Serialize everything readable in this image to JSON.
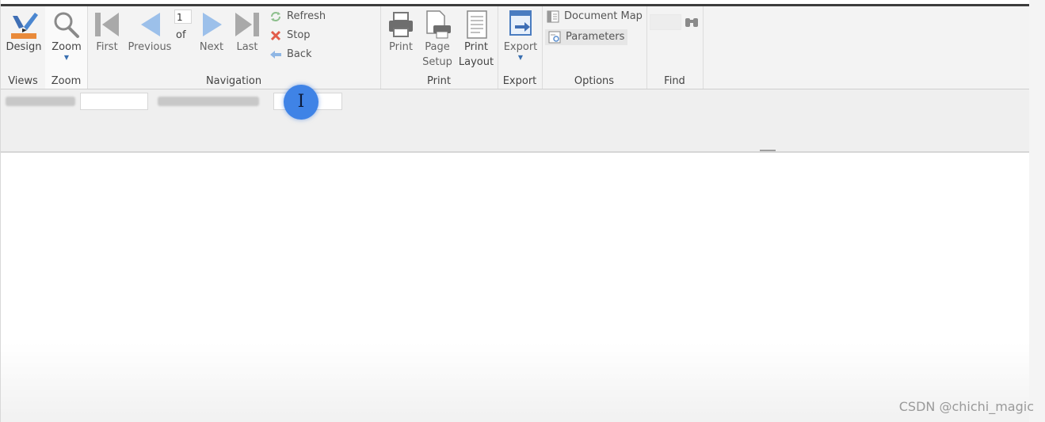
{
  "ribbon": {
    "views": {
      "design_label": "Design",
      "group_label": "Views"
    },
    "zoom": {
      "zoom_label": "Zoom",
      "group_label": "Zoom"
    },
    "navigation": {
      "first_label": "First",
      "previous_label": "Previous",
      "page_value": "1",
      "of_label": "of",
      "next_label": "Next",
      "last_label": "Last",
      "refresh_label": "Refresh",
      "stop_label": "Stop",
      "back_label": "Back",
      "group_label": "Navigation"
    },
    "print": {
      "print_label": "Print",
      "page_setup_line1": "Page",
      "page_setup_line2": "Setup",
      "print_layout_line1": "Print",
      "print_layout_line2": "Layout",
      "group_label": "Print"
    },
    "export": {
      "export_label": "Export",
      "group_label": "Export"
    },
    "options": {
      "document_map_label": "Document Map",
      "parameters_label": "Parameters",
      "group_label": "Options"
    },
    "find": {
      "group_label": "Find"
    }
  },
  "parameters_bar": {
    "param1_value": "",
    "param2_value": ""
  },
  "watermark": "CSDN @chichi_magic",
  "colors": {
    "accent_blue": "#3f83e6",
    "icon_blue": "#9cc0ea",
    "icon_gray": "#9a9a9a"
  }
}
